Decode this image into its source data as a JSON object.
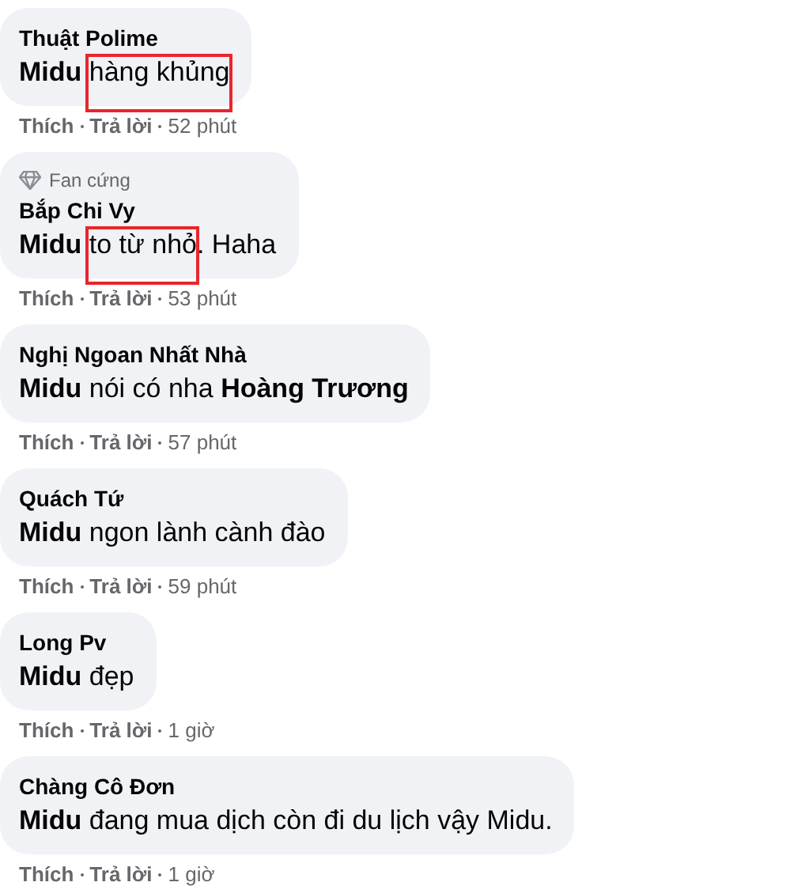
{
  "comments": [
    {
      "author": "Thuật Polime",
      "parts": [
        {
          "text": "**Midu** ",
          "highlighted": false
        },
        {
          "text": "hàng khủng",
          "highlighted": true
        }
      ],
      "actions": [
        "Thích",
        "Trả lời"
      ],
      "time": "52 phút"
    },
    {
      "badge": "Fan cứng",
      "author": "Bắp Chi Vy",
      "parts": [
        {
          "text": "**Midu** ",
          "highlighted": false
        },
        {
          "text": "to từ nhỏ",
          "highlighted": true
        },
        {
          "text": ". Haha",
          "highlighted": false
        }
      ],
      "actions": [
        "Thích",
        "Trả lời"
      ],
      "time": "53 phút"
    },
    {
      "author": "Nghị Ngoan Nhất Nhà",
      "parts": [
        {
          "text": "**Midu** nói có nha **Hoàng Trương**",
          "highlighted": false
        }
      ],
      "actions": [
        "Thích",
        "Trả lời"
      ],
      "time": "57 phút"
    },
    {
      "author": "Quách Tứ",
      "parts": [
        {
          "text": "**Midu** ngon lành cành đào",
          "highlighted": false
        }
      ],
      "actions": [
        "Thích",
        "Trả lời"
      ],
      "time": "59 phút"
    },
    {
      "author": "Long Pv",
      "parts": [
        {
          "text": "**Midu** đẹp",
          "highlighted": false
        }
      ],
      "actions": [
        "Thích",
        "Trả lời"
      ],
      "time": "1 giờ"
    },
    {
      "author": "Chàng Cô Đơn",
      "parts": [
        {
          "text": "**Midu** đang mua dịch còn đi du lịch vậy Midu.",
          "highlighted": false
        }
      ],
      "actions": [
        "Thích",
        "Trả lời"
      ],
      "time": "1 giờ"
    }
  ]
}
